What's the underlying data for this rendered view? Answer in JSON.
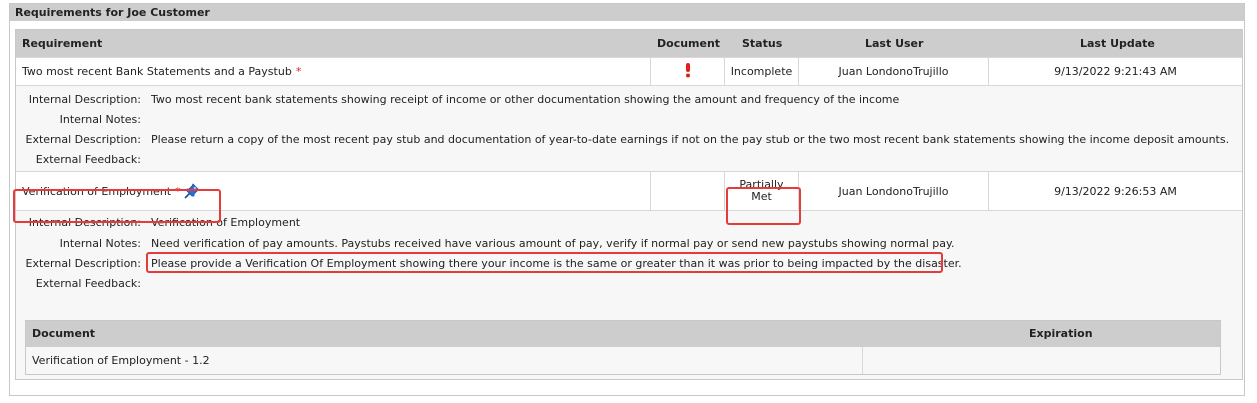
{
  "panel": {
    "title": "Requirements for Joe Customer"
  },
  "table": {
    "headers": {
      "requirement": "Requirement",
      "document": "Document",
      "status": "Status",
      "last_user": "Last User",
      "last_update": "Last Update"
    },
    "rows": [
      {
        "requirement": "Two most recent Bank Statements and a Paystub",
        "required_marker": "*",
        "document_icon": "exclamation-icon",
        "status": "Incomplete",
        "last_user": "Juan LondonoTrujillo",
        "last_update": "9/13/2022 9:21:43 AM",
        "details": {
          "internal_description_label": "Internal Description:",
          "internal_description": "Two most recent bank statements showing receipt of income or other documentation showing the amount and frequency of the income",
          "internal_notes_label": "Internal Notes:",
          "internal_notes": "",
          "external_description_label": "External Description:",
          "external_description": "Please return a copy of the most recent pay stub and documentation of year-to-date earnings if not on the pay stub or the two most recent bank statements showing the income deposit amounts.",
          "external_feedback_label": "External Feedback:",
          "external_feedback": ""
        }
      },
      {
        "requirement": "Verification of Employment",
        "required_marker": "*",
        "pin_icon": "pushpin-icon",
        "status": "Partially Met",
        "last_user": "Juan LondonoTrujillo",
        "last_update": "9/13/2022 9:26:53 AM",
        "details": {
          "internal_description_label": "Internal Description:",
          "internal_description": "Verification of Employment",
          "internal_notes_label": "Internal Notes:",
          "internal_notes": "Need verification of pay amounts. Paystubs received have various amount of pay, verify if normal pay or send new paystubs showing normal pay.",
          "external_description_label": "External Description:",
          "external_description": "Please provide a Verification Of Employment showing there your income is the same or greater than it was prior to being impacted by the disaster.",
          "external_feedback_label": "External Feedback:",
          "external_feedback": ""
        }
      }
    ]
  },
  "documents": {
    "headers": {
      "document": "Document",
      "expiration": "Expiration"
    },
    "rows": [
      {
        "document": "Verification of Employment - 1.2",
        "expiration": ""
      }
    ]
  },
  "colors": {
    "highlight": "#e53b3b",
    "header_bg": "#cdcdcd",
    "required": "#e02020",
    "pin": "#2a6fd6"
  }
}
